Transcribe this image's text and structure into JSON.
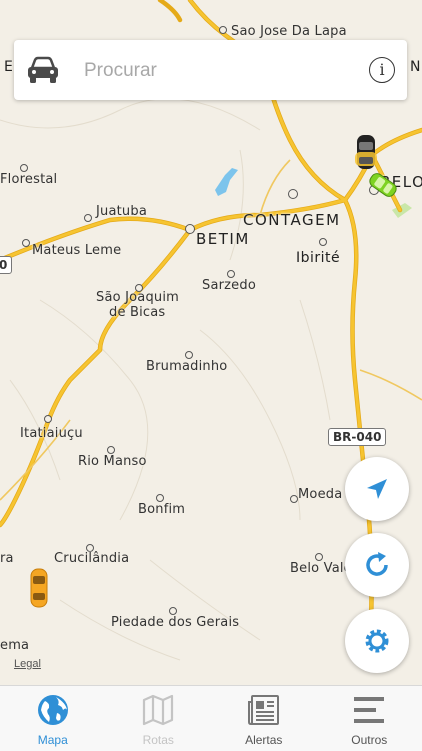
{
  "search": {
    "placeholder": "Procurar",
    "car_icon": "car-icon",
    "info_icon": "info-icon"
  },
  "map": {
    "places": [
      {
        "name": "São José Da Lapa",
        "label": "Sao Jose Da Lapa"
      },
      {
        "name": "Florestal",
        "label": "Florestal"
      },
      {
        "name": "Juatuba",
        "label": "Juatuba"
      },
      {
        "name": "Mateus Leme",
        "label": "Mateus Leme"
      },
      {
        "name": "Betim",
        "label": "BETIM"
      },
      {
        "name": "Contagem",
        "label": "CONTAGEM"
      },
      {
        "name": "Ibirité",
        "label": "Ibirité"
      },
      {
        "name": "Sarzedo",
        "label": "Sarzedo"
      },
      {
        "name": "São Joaquim de Bicas",
        "label": "São Joaquim"
      },
      {
        "name": "São Joaquim de Bicas line 2",
        "label": "de Bicas"
      },
      {
        "name": "Brumadinho",
        "label": "Brumadinho"
      },
      {
        "name": "Itatiaiuçu",
        "label": "Itatiaiuçu"
      },
      {
        "name": "Rio Manso",
        "label": "Rio Manso"
      },
      {
        "name": "Bonfim",
        "label": "Bonfim"
      },
      {
        "name": "Moeda",
        "label": "Moeda"
      },
      {
        "name": "Crucilândia",
        "label": "Crucilândia"
      },
      {
        "name": "Belo Vale",
        "label": "Belo Vale"
      },
      {
        "name": "Piedade dos Gerais",
        "label": "Piedade dos Gerais"
      },
      {
        "name": "Belo Horizonte",
        "label": "BELO"
      },
      {
        "name": "edge-left-1",
        "label": "ra"
      },
      {
        "name": "edge-left-2",
        "label": "ema"
      },
      {
        "name": "edge-top-left",
        "label": "E"
      },
      {
        "name": "edge-top-right",
        "label": "N"
      }
    ],
    "road_shield": "BR-040",
    "road_shield_left": "0",
    "legal": "Legal",
    "colors": {
      "land": "#f3efe6",
      "highway": "#f6c431",
      "water": "#7cc4ec",
      "park": "#c9e7a8"
    }
  },
  "buttons": {
    "locate_icon": "navigation-arrow-icon",
    "refresh_icon": "refresh-icon",
    "settings_icon": "gear-icon",
    "accent": "#2f8fd6"
  },
  "tabs": [
    {
      "label": "Mapa",
      "icon": "globe-icon",
      "active": true
    },
    {
      "label": "Rotas",
      "icon": "map-icon",
      "active": false,
      "disabled": true
    },
    {
      "label": "Alertas",
      "icon": "newspaper-icon",
      "active": false
    },
    {
      "label": "Outros",
      "icon": "menu-icon",
      "active": false
    }
  ]
}
